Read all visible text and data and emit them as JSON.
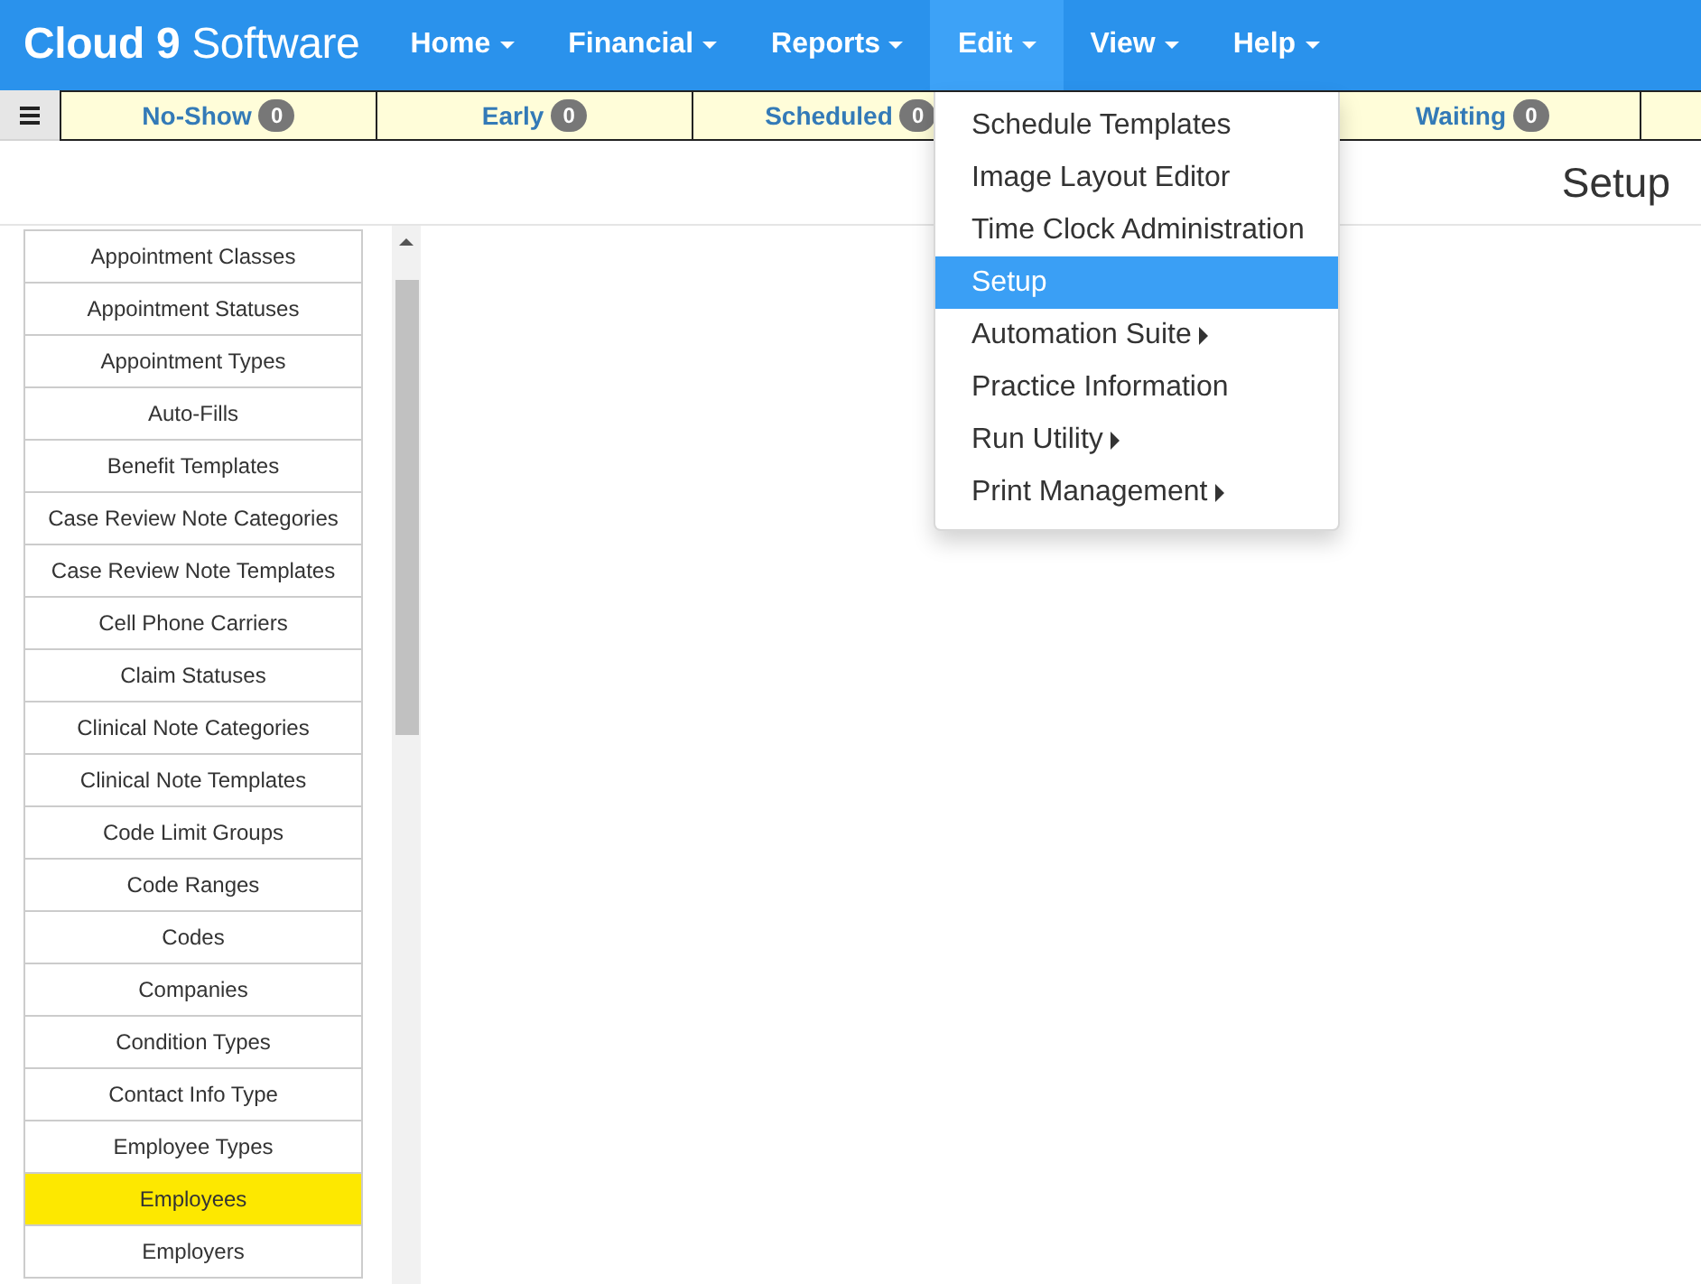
{
  "brand": {
    "logo": "**Cloud 9** Software"
  },
  "nav": [
    {
      "label": "Home",
      "selected": false
    },
    {
      "label": "Financial",
      "selected": false
    },
    {
      "label": "Reports",
      "selected": false
    },
    {
      "label": "Edit",
      "selected": true
    },
    {
      "label": "View",
      "selected": false
    },
    {
      "label": "Help",
      "selected": false
    }
  ],
  "status_filters": [
    {
      "label": "No-Show",
      "count": "0"
    },
    {
      "label": "Early",
      "count": "0"
    },
    {
      "label": "Scheduled",
      "count": "0"
    },
    {
      "label": "Waiting",
      "count": "0"
    }
  ],
  "page_title": "Setup",
  "edit_menu": {
    "items": [
      {
        "label": "Schedule Templates",
        "selected": false,
        "submenu": false
      },
      {
        "label": "Image Layout Editor",
        "selected": false,
        "submenu": false
      },
      {
        "label": "Time Clock Administration",
        "selected": false,
        "submenu": false
      },
      {
        "label": "Setup",
        "selected": true,
        "submenu": false
      },
      {
        "label": "Automation Suite",
        "selected": false,
        "submenu": true
      },
      {
        "label": "Practice Information",
        "selected": false,
        "submenu": false
      },
      {
        "label": "Run Utility",
        "selected": false,
        "submenu": true
      },
      {
        "label": "Print Management",
        "selected": false,
        "submenu": true
      }
    ]
  },
  "sidebar": {
    "items": [
      {
        "label": "Appointment Classes",
        "highlighted": false
      },
      {
        "label": "Appointment Statuses",
        "highlighted": false
      },
      {
        "label": "Appointment Types",
        "highlighted": false
      },
      {
        "label": "Auto-Fills",
        "highlighted": false
      },
      {
        "label": "Benefit Templates",
        "highlighted": false
      },
      {
        "label": "Case Review Note Categories",
        "highlighted": false
      },
      {
        "label": "Case Review Note Templates",
        "highlighted": false
      },
      {
        "label": "Cell Phone Carriers",
        "highlighted": false
      },
      {
        "label": "Claim Statuses",
        "highlighted": false
      },
      {
        "label": "Clinical Note Categories",
        "highlighted": false
      },
      {
        "label": "Clinical Note Templates",
        "highlighted": false
      },
      {
        "label": "Code Limit Groups",
        "highlighted": false
      },
      {
        "label": "Code Ranges",
        "highlighted": false
      },
      {
        "label": "Codes",
        "highlighted": false
      },
      {
        "label": "Companies",
        "highlighted": false
      },
      {
        "label": "Condition Types",
        "highlighted": false
      },
      {
        "label": "Contact Info Type",
        "highlighted": false
      },
      {
        "label": "Employee Types",
        "highlighted": false
      },
      {
        "label": "Employees",
        "highlighted": true
      },
      {
        "label": "Employers",
        "highlighted": false
      }
    ]
  }
}
